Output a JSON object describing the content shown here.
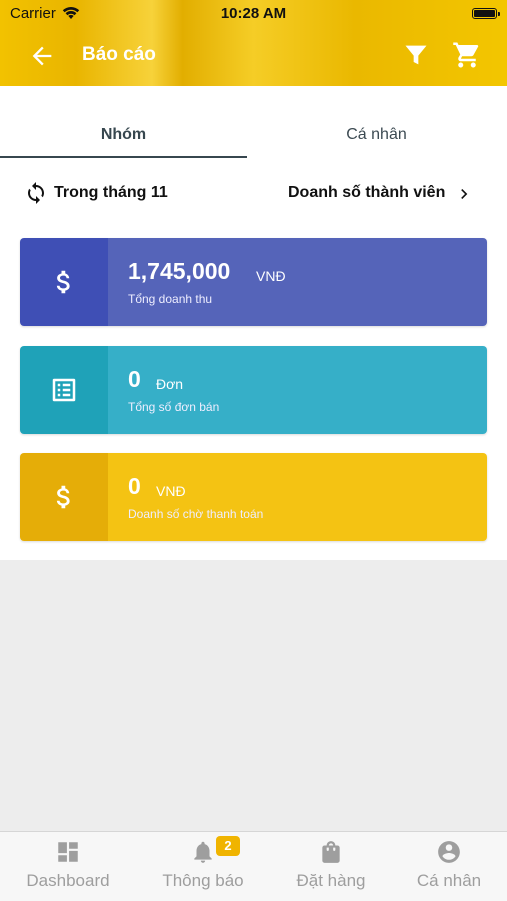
{
  "status_bar": {
    "carrier": "Carrier",
    "time": "10:28 AM"
  },
  "nav": {
    "title": "Báo cáo"
  },
  "tabs": [
    {
      "label": "Nhóm",
      "selected": true
    },
    {
      "label": "Cá nhân",
      "selected": false
    }
  ],
  "period": {
    "label": "Trong tháng 11"
  },
  "members_link": {
    "label": "Doanh số thành viên"
  },
  "cards": [
    {
      "value": "1,745,000",
      "unit": "VNĐ",
      "caption": "Tổng doanh thu",
      "icon": "dollar-icon",
      "color": "#5564b9"
    },
    {
      "value": "0",
      "unit": "Đơn",
      "caption": "Tổng số đơn bán",
      "icon": "list-icon",
      "color": "#36afc8"
    },
    {
      "value": "0",
      "unit": "VNĐ",
      "caption": "Doanh số chờ thanh toán",
      "icon": "dollar-icon",
      "color": "#f4c313"
    }
  ],
  "tabbar": [
    {
      "label": "Dashboard",
      "icon": "dashboard-icon"
    },
    {
      "label": "Thông báo",
      "icon": "bell-icon",
      "badge": "2"
    },
    {
      "label": "Đặt hàng",
      "icon": "shopping-bag-icon"
    },
    {
      "label": "Cá nhân",
      "icon": "account-icon"
    }
  ],
  "colors": {
    "accent": "#f2c200",
    "tab_text": "#37474f",
    "inactive": "#9e9e9e"
  }
}
